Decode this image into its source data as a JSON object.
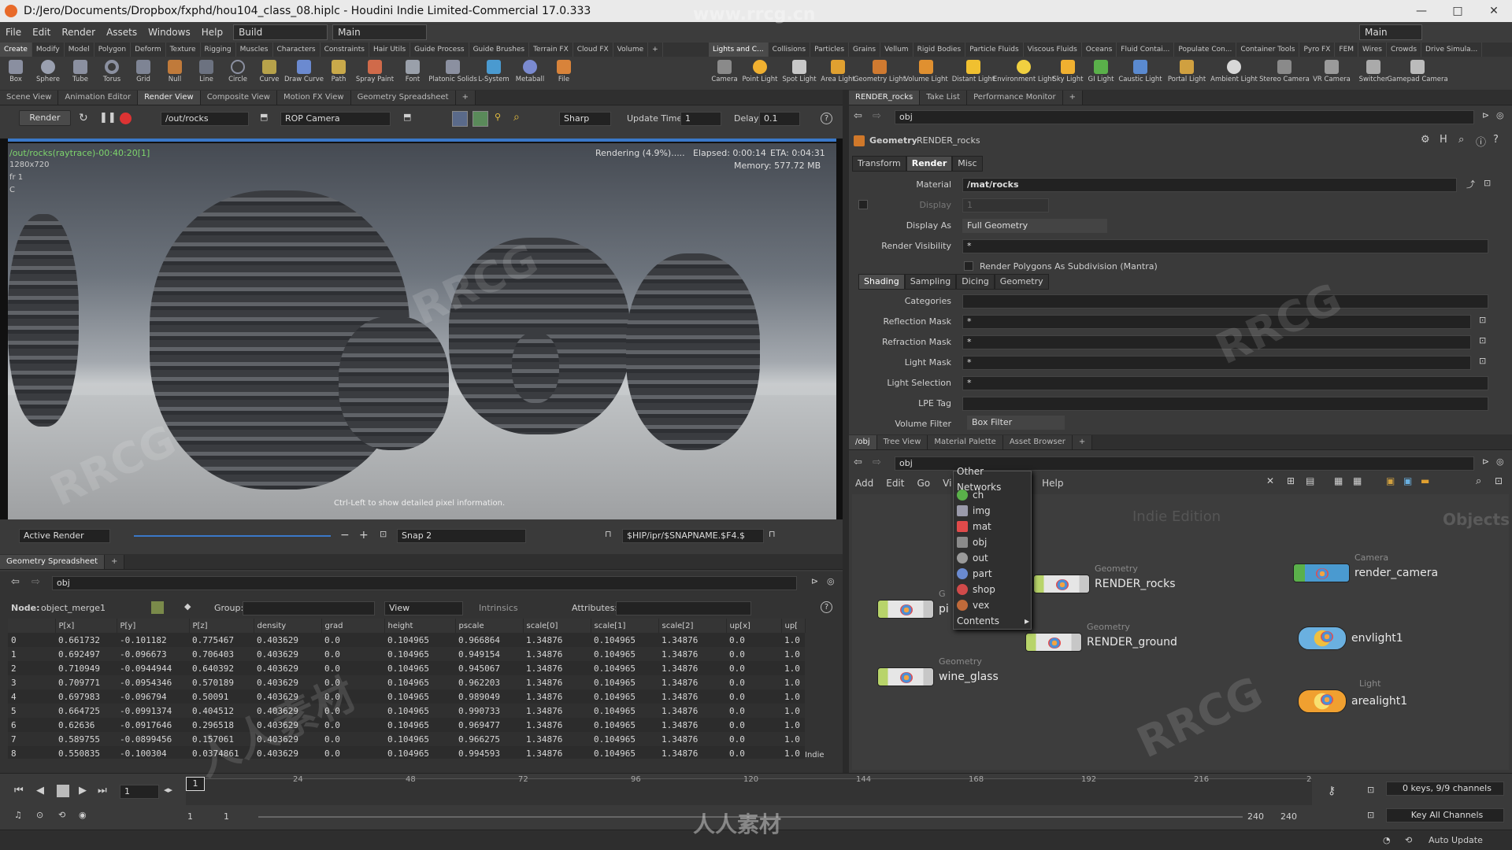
{
  "window": {
    "title": "D:/Jero/Documents/Dropbox/fxphd/hou104_class_08.hiplc - Houdini Indie Limited-Commercial 17.0.333",
    "minimize": "—",
    "maximize": "□",
    "close": "✕"
  },
  "menubar": {
    "items": [
      "File",
      "Edit",
      "Render",
      "Assets",
      "Windows",
      "Help"
    ],
    "desktop": "Build",
    "desktop2": "Main",
    "right_desktop": "Main"
  },
  "shelf_left": {
    "tabs": [
      "Create",
      "Modify",
      "Model",
      "Polygon",
      "Deform",
      "Texture",
      "Rigging",
      "Muscles",
      "Characters",
      "Constraints",
      "Hair Utils",
      "Guide Process",
      "Guide Brushes",
      "Terrain FX",
      "Cloud FX",
      "Volume"
    ],
    "tools": [
      "Box",
      "Sphere",
      "Tube",
      "Torus",
      "Grid",
      "Null",
      "Line",
      "Circle",
      "Curve",
      "Draw Curve",
      "Path",
      "Spray Paint",
      "Font",
      "Platonic Solids",
      "L-System",
      "Metaball",
      "File"
    ]
  },
  "shelf_right": {
    "tabs": [
      "Lights and C...",
      "Collisions",
      "Particles",
      "Grains",
      "Vellum",
      "Rigid Bodies",
      "Particle Fluids",
      "Viscous Fluids",
      "Oceans",
      "Fluid Contai...",
      "Populate Con...",
      "Container Tools",
      "Pyro FX",
      "FEM",
      "Wires",
      "Crowds",
      "Drive Simula..."
    ],
    "tools": [
      "Camera",
      "Point Light",
      "Spot Light",
      "Area Light",
      "Geometry Light",
      "Volume Light",
      "Distant Light",
      "Environment Light",
      "Sky Light",
      "GI Light",
      "Caustic Light",
      "Portal Light",
      "Ambient Light",
      "Stereo Camera",
      "VR Camera",
      "Switcher",
      "Gamepad Camera"
    ]
  },
  "left_pane": {
    "tabs": [
      "Scene View",
      "Animation Editor",
      "Render View",
      "Composite View",
      "Motion FX View",
      "Geometry Spreadsheet"
    ],
    "active_tab": "Render View",
    "render_button": "Render",
    "rop_path": "/out/rocks",
    "camera": "ROP Camera",
    "sharp": "Sharp",
    "update_time_label": "Update Time",
    "update_time_value": "1",
    "delay_label": "Delay",
    "delay_value": "0.1",
    "overlay_path": "/out/rocks(raytrace)-00:40:20[1]",
    "resolution": "1280x720",
    "frame": "fr 1",
    "channel": "C",
    "rendering_status": "Rendering (4.9%).....",
    "elapsed": "Elapsed: 0:00:14",
    "eta": "ETA: 0:04:31",
    "memory": "Memory:   577.72 MB",
    "hint": "Ctrl-Left to show detailed pixel information.",
    "active_render": "Active Render",
    "snap": "Snap 2",
    "snap_path": "$HIP/ipr/$SNAPNAME.$F4.$"
  },
  "spreadsheet": {
    "tab": "Geometry Spreadsheet",
    "path": "obj",
    "node_label": "Node:",
    "node_value": "object_merge1",
    "group_label": "Group:",
    "view_label": "View",
    "intrinsics_label": "Intrinsics",
    "attributes_label": "Attributes:",
    "columns": [
      "",
      "P[x]",
      "P[y]",
      "P[z]",
      "density",
      "grad",
      "height",
      "pscale",
      "scale[0]",
      "scale[1]",
      "scale[2]",
      "up[x]",
      "up["
    ],
    "rows": [
      [
        "0",
        "0.661732",
        "-0.101182",
        "0.775467",
        "0.403629",
        "0.0",
        "0.104965",
        "0.966864",
        "1.34876",
        "0.104965",
        "1.34876",
        "0.0",
        "1.0"
      ],
      [
        "1",
        "0.692497",
        "-0.096673",
        "0.706403",
        "0.403629",
        "0.0",
        "0.104965",
        "0.949154",
        "1.34876",
        "0.104965",
        "1.34876",
        "0.0",
        "1.0"
      ],
      [
        "2",
        "0.710949",
        "-0.0944944",
        "0.640392",
        "0.403629",
        "0.0",
        "0.104965",
        "0.945067",
        "1.34876",
        "0.104965",
        "1.34876",
        "0.0",
        "1.0"
      ],
      [
        "3",
        "0.709771",
        "-0.0954346",
        "0.570189",
        "0.403629",
        "0.0",
        "0.104965",
        "0.962203",
        "1.34876",
        "0.104965",
        "1.34876",
        "0.0",
        "1.0"
      ],
      [
        "4",
        "0.697983",
        "-0.096794",
        "0.50091",
        "0.403629",
        "0.0",
        "0.104965",
        "0.989049",
        "1.34876",
        "0.104965",
        "1.34876",
        "0.0",
        "1.0"
      ],
      [
        "5",
        "0.664725",
        "-0.0991374",
        "0.404512",
        "0.403629",
        "0.0",
        "0.104965",
        "0.990733",
        "1.34876",
        "0.104965",
        "1.34876",
        "0.0",
        "1.0"
      ],
      [
        "6",
        "0.62636",
        "-0.0917646",
        "0.296518",
        "0.403629",
        "0.0",
        "0.104965",
        "0.969477",
        "1.34876",
        "0.104965",
        "1.34876",
        "0.0",
        "1.0"
      ],
      [
        "7",
        "0.589755",
        "-0.0899456",
        "0.157061",
        "0.403629",
        "0.0",
        "0.104965",
        "0.966275",
        "1.34876",
        "0.104965",
        "1.34876",
        "0.0",
        "1.0"
      ],
      [
        "8",
        "0.550835",
        "-0.100304",
        "0.0374861",
        "0.403629",
        "0.0",
        "0.104965",
        "0.994593",
        "1.34876",
        "0.104965",
        "1.34876",
        "0.0",
        "1.0"
      ]
    ],
    "indie": "Indie"
  },
  "params": {
    "tabs": [
      "RENDER_rocks",
      "Take List",
      "Performance Monitor"
    ],
    "path": "obj",
    "node_type": "Geometry",
    "node_name": "RENDER_rocks",
    "subtabs": [
      "Transform",
      "Render",
      "Misc"
    ],
    "active_subtab": "Render",
    "material_label": "Material",
    "material_value": "/mat/rocks",
    "display_label": "Display",
    "display_value": "1",
    "display_as_label": "Display As",
    "display_as_value": "Full Geometry",
    "render_visibility_label": "Render Visibility",
    "render_visibility_value": "*",
    "subdivision_label": "Render Polygons As Subdivision (Mantra)",
    "render_tabs": [
      "Shading",
      "Sampling",
      "Dicing",
      "Geometry"
    ],
    "categories_label": "Categories",
    "reflection_mask_label": "Reflection Mask",
    "reflection_mask_value": "*",
    "refraction_mask_label": "Refraction Mask",
    "refraction_mask_value": "*",
    "light_mask_label": "Light Mask",
    "light_mask_value": "*",
    "light_selection_label": "Light Selection",
    "light_selection_value": "*",
    "lpe_tag_label": "LPE Tag",
    "volume_filter_label": "Volume Filter",
    "volume_filter_value": "Box Filter"
  },
  "network": {
    "tabs": [
      "/obj",
      "Tree View",
      "Material Palette",
      "Asset Browser"
    ],
    "path": "obj",
    "menu": [
      "Add",
      "Edit",
      "Go",
      "Vi",
      "t",
      "Help"
    ],
    "indie_edition": "Indie Edition",
    "context": "Objects",
    "nodes": [
      {
        "type": "Geometry",
        "name": "RENDER_rocks"
      },
      {
        "type": "Geometry",
        "name": "RENDER_ground"
      },
      {
        "type": "Geometry",
        "name": "wine_glass"
      },
      {
        "type": "G",
        "name": "pi"
      },
      {
        "type": "Camera",
        "name": "render_camera"
      },
      {
        "type": "",
        "name": "envlight1"
      },
      {
        "type": "Light",
        "name": "arealight1"
      }
    ],
    "popup": {
      "header": "Other Networks",
      "items": [
        "ch",
        "img",
        "mat",
        "obj",
        "out",
        "part",
        "shop",
        "vex",
        "Contents"
      ]
    }
  },
  "timeline": {
    "frame": "1",
    "ticks": [
      "24",
      "48",
      "72",
      "96",
      "120",
      "144",
      "168",
      "192",
      "216",
      "2"
    ],
    "start": "1",
    "start2": "1",
    "end": "240",
    "end2": "240",
    "keys": "0 keys, 9/9 channels",
    "key_all": "Key All Channels",
    "auto_update": "Auto Update"
  },
  "watermarks": [
    "www.rrcg.cn",
    "RRCG",
    "人人素材"
  ]
}
